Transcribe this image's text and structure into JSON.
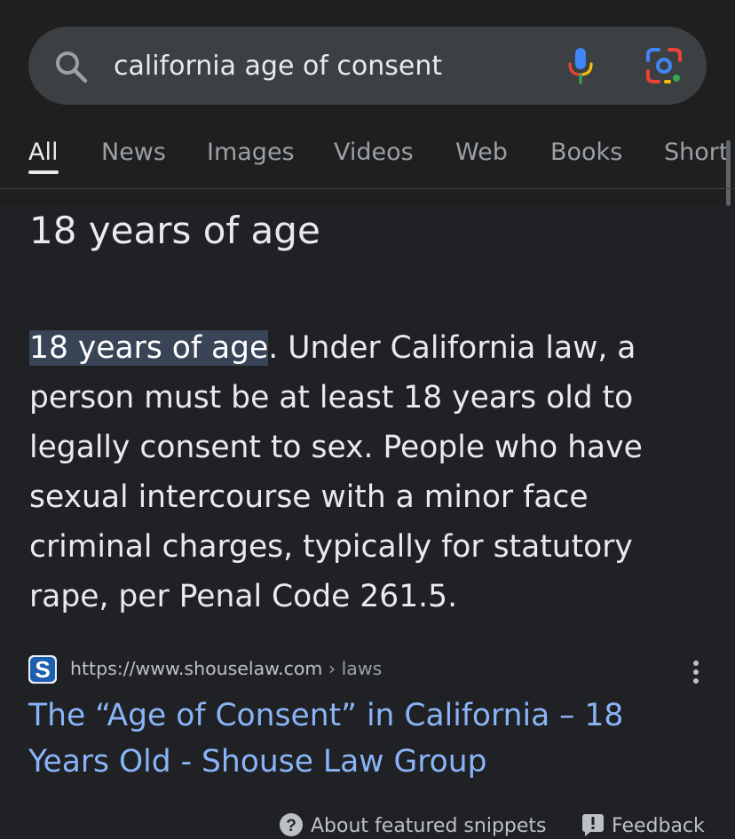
{
  "search": {
    "query": "california age of consent"
  },
  "tabs": [
    {
      "label": "All",
      "active": true
    },
    {
      "label": "News"
    },
    {
      "label": "Images"
    },
    {
      "label": "Videos"
    },
    {
      "label": "Web"
    },
    {
      "label": "Books"
    },
    {
      "label": "Short"
    }
  ],
  "featured_snippet": {
    "answer": "18 years of age",
    "highlight": "18 years of age",
    "body": ". Under California law, a person must be at least 18 years old to legally consent to sex. People who have sexual intercourse with a minor face criminal charges, typically for statutory rape, per Penal Code 261.5."
  },
  "source": {
    "url": "https://www.shouselaw.com",
    "breadcrumb": " › laws",
    "favicon_letter": "S",
    "title": "The “Age of Consent” in California – 18 Years Old - Shouse Law Group"
  },
  "footer": {
    "about": "About featured snippets",
    "feedback": "Feedback"
  },
  "icons": {
    "search": "search-icon",
    "mic": "mic-icon",
    "lens": "lens-icon",
    "kebab": "more-vert-icon",
    "help": "help-icon",
    "feedback": "feedback-icon"
  },
  "colors": {
    "background": "#202124",
    "link": "#8ab4f8",
    "highlight": "#394457"
  }
}
